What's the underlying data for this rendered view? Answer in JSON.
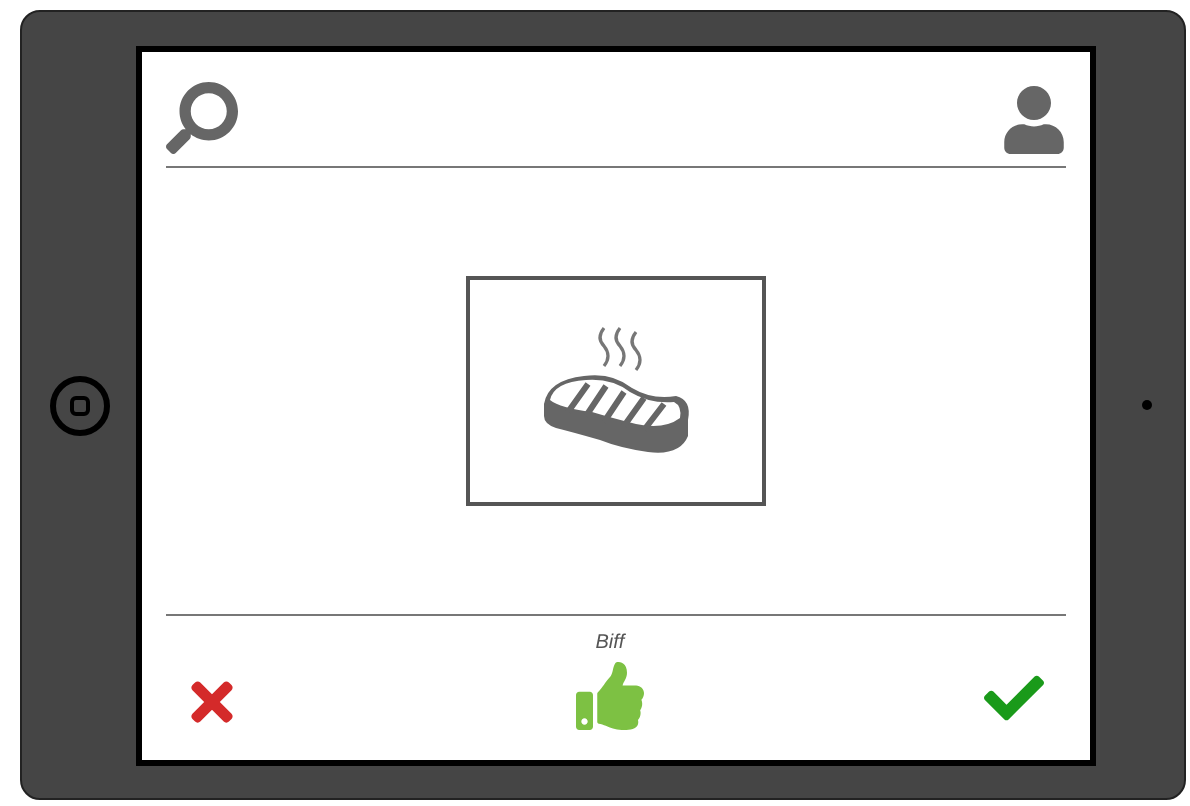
{
  "caption": "Biff"
}
